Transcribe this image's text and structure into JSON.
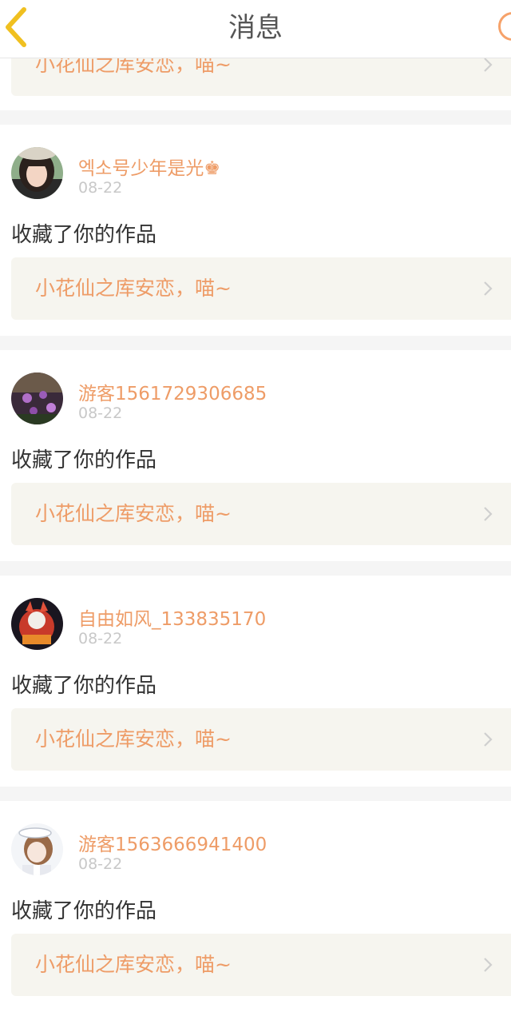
{
  "header": {
    "title": "消息",
    "back_icon": "chevron-left-icon",
    "right_icon": "circle-icon"
  },
  "top_card": {
    "work_title": "小花仙之库安恋，喵~"
  },
  "messages": [
    {
      "username": "엑소号少年是光♚",
      "date": "08-22",
      "action": "收藏了你的作品",
      "work_title": "小花仙之库安恋，喵~"
    },
    {
      "username": "游客1561729306685",
      "date": "08-22",
      "action": "收藏了你的作品",
      "work_title": "小花仙之库安恋，喵~"
    },
    {
      "username": "自由如风_133835170",
      "date": "08-22",
      "action": "收藏了你的作品",
      "work_title": "小花仙之库安恋，喵~"
    },
    {
      "username": "游客1563666941400",
      "date": "08-22",
      "action": "收藏了你的作品",
      "work_title": "小花仙之库安恋，喵~"
    }
  ],
  "colors": {
    "accent": "#ee9c67",
    "back_arrow": "#f0c020",
    "card_bg": "#f6f5ef"
  }
}
